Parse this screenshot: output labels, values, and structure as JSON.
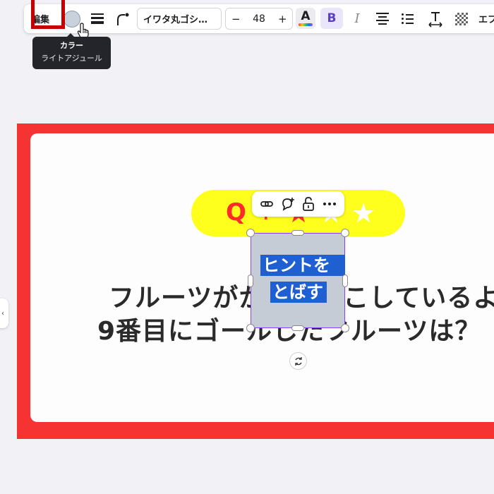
{
  "toolbar": {
    "edit_label": "編集",
    "font_name": "イワタ丸ゴシ…",
    "font_size": "48",
    "minus": "−",
    "plus": "+",
    "text_color_letter": "A",
    "bold_letter": "B",
    "italic_letter": "I",
    "effects_label": "エフ",
    "swatch_color": "#c9d1dd",
    "highlight_frame_color": "#c60000"
  },
  "tooltip": {
    "title": "カラー",
    "color_name": "ライトアジュール"
  },
  "side_tab": {
    "glyph": "‹"
  },
  "slide": {
    "border_color": "#f53333",
    "pill_color": "#ffff1e",
    "pill_letter": "Q",
    "line1": "フルーツがかとばすこしているよ",
    "line2": "9番目にゴールしたフルーツは？",
    "selection_line1": "ヒントを",
    "selection_line2": "とばす",
    "selection_fill": "#c5ccd6",
    "text_highlight": "#1e5fd1"
  },
  "icons": {
    "link": "link-icon",
    "comment": "comment-add-icon",
    "lock": "lock-icon",
    "more": "more-icon",
    "rotate": "rotate-icon"
  }
}
